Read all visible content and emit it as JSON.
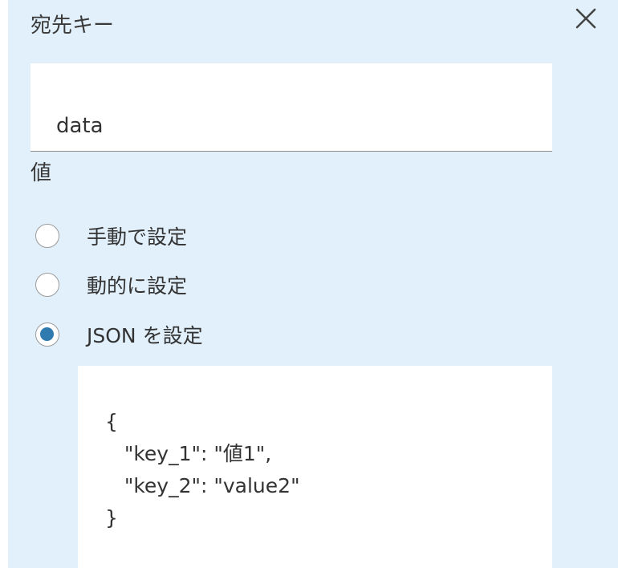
{
  "dialog": {
    "title": "宛先キー",
    "close_icon": "close-icon"
  },
  "destination_key": {
    "value": "data"
  },
  "value_section": {
    "label": "値",
    "options": [
      {
        "label": "手動で設定",
        "selected": false
      },
      {
        "label": "動的に設定",
        "selected": false
      },
      {
        "label": "JSON を設定",
        "selected": true
      }
    ]
  },
  "json_editor": {
    "content": "{\n   \"key_1\": \"値1\",\n   \"key_2\": \"value2\"\n}"
  },
  "colors": {
    "panel_background": "#e2f0fb",
    "radio_selected": "#2f7bb0",
    "field_background": "#ffffff"
  }
}
